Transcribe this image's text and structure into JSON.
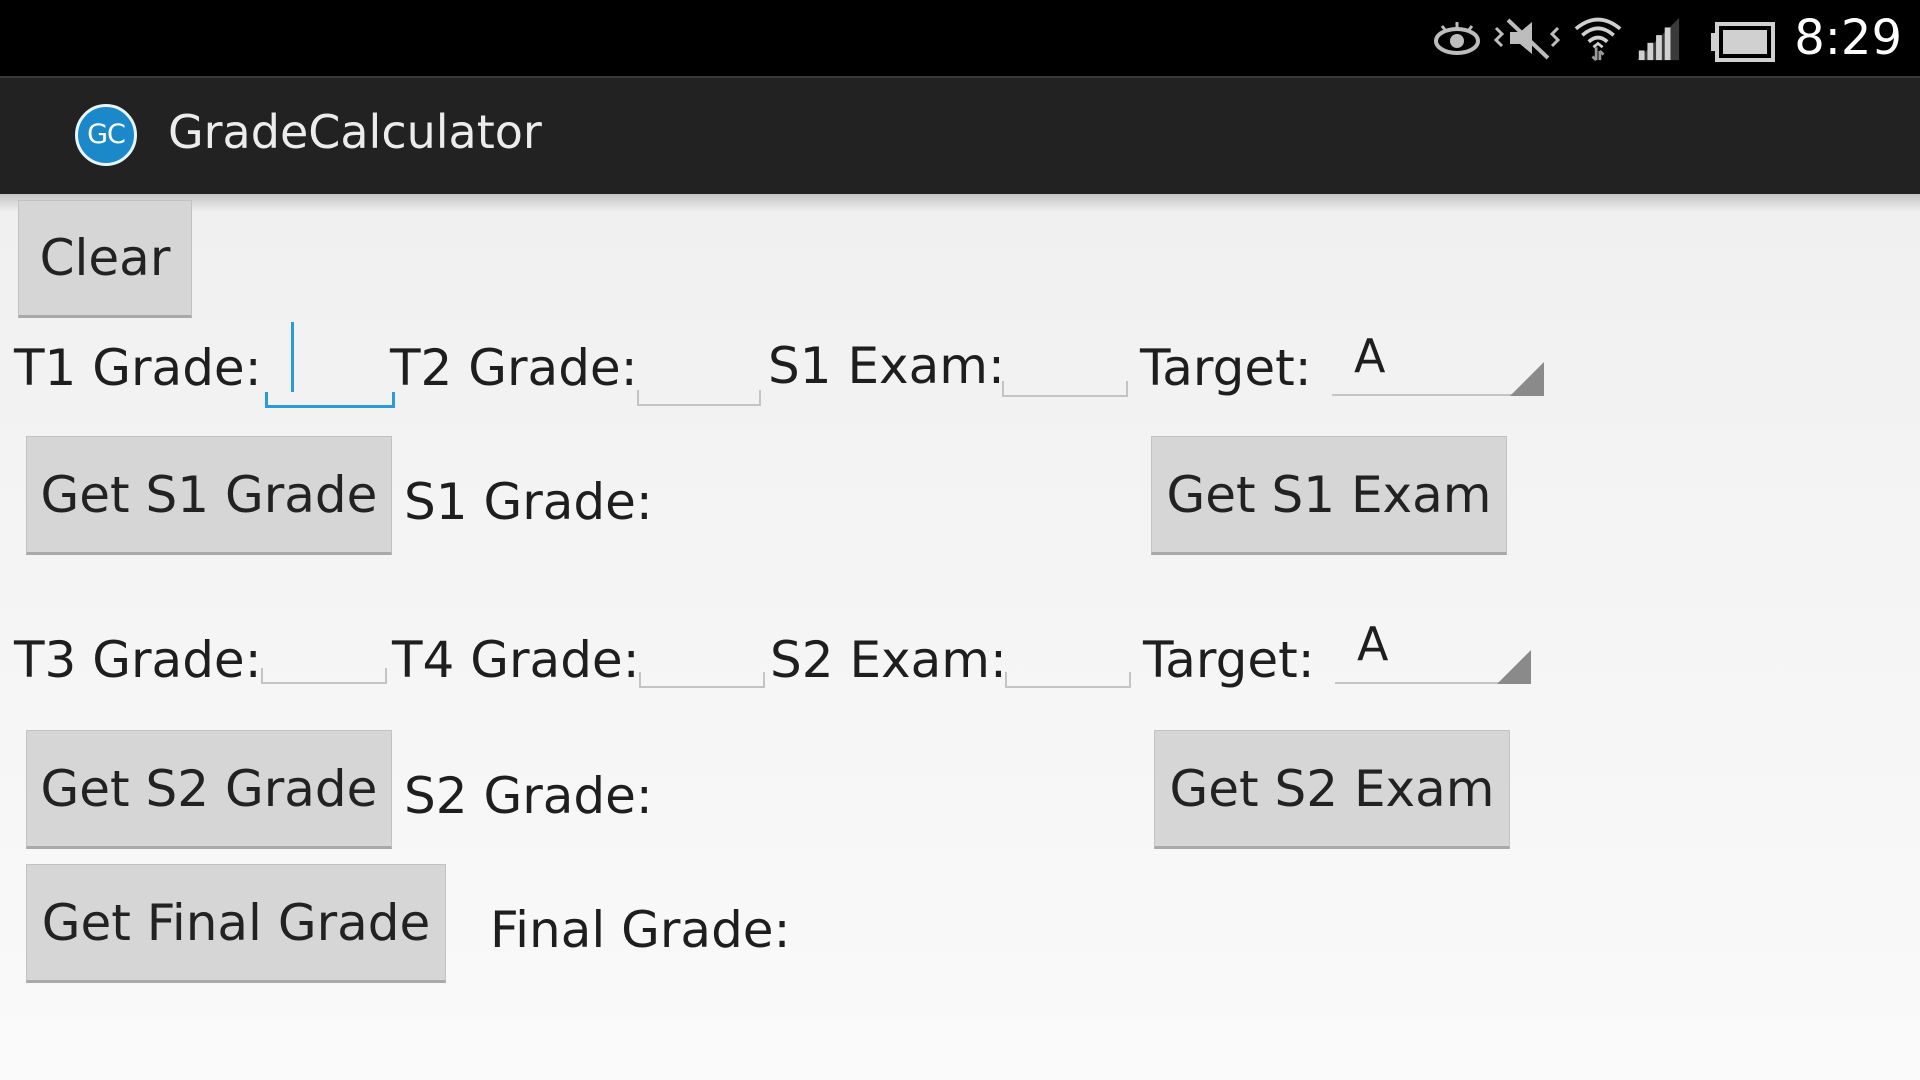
{
  "status_bar": {
    "time": "8:29",
    "icons": [
      "eye-icon",
      "vibrate-silent-icon",
      "wifi-icon",
      "signal-icon",
      "battery-icon"
    ]
  },
  "app": {
    "icon_text": "GC",
    "title": "GradeCalculator"
  },
  "buttons": {
    "clear": "Clear",
    "get_s1_grade": "Get S1 Grade",
    "get_s1_exam": "Get S1 Exam",
    "get_s2_grade": "Get S2 Grade",
    "get_s2_exam": "Get S2 Exam",
    "get_final_grade": "Get Final Grade"
  },
  "semester1": {
    "t1_label": "T1 Grade:",
    "t1_value": "",
    "t2_label": "T2 Grade:",
    "t2_value": "",
    "exam_label": "S1 Exam:",
    "exam_value": "",
    "target_label": "Target:",
    "target_value": "A",
    "grade_label": "S1 Grade:"
  },
  "semester2": {
    "t3_label": "T3 Grade:",
    "t3_value": "",
    "t4_label": "T4 Grade:",
    "t4_value": "",
    "exam_label": "S2 Exam:",
    "exam_value": "",
    "target_label": "Target:",
    "target_value": "A",
    "grade_label": "S2 Grade:"
  },
  "final": {
    "label": "Final Grade:"
  },
  "colors": {
    "accent": "#2b9bd8",
    "action_bar": "#222222",
    "app_icon": "#1b89c9",
    "button": "#d6d6d6"
  }
}
